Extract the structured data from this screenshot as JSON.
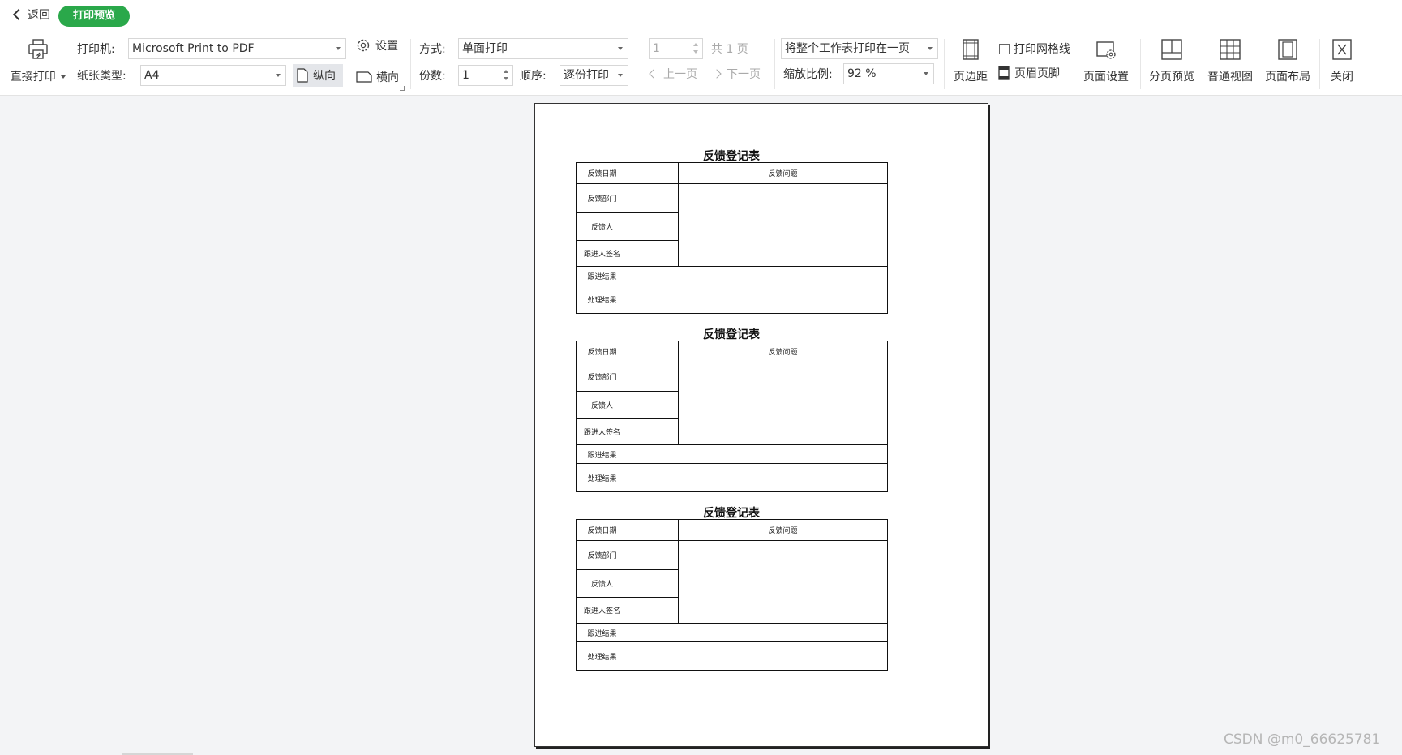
{
  "topbar": {
    "back_label": "返回",
    "mode_label": "打印预览"
  },
  "print": {
    "direct_label": "直接打印",
    "printer_label": "打印机:",
    "printer_value": "Microsoft Print to PDF",
    "settings_label": "设置",
    "paper_label": "纸张类型:",
    "paper_value": "A4",
    "portrait_label": "纵向",
    "landscape_label": "横向",
    "orientation_selected": "portrait"
  },
  "mode": {
    "method_label": "方式:",
    "method_value": "单面打印",
    "copies_label": "份数:",
    "copies_value": "1",
    "order_label": "顺序:",
    "order_value": "逐份打印"
  },
  "pager": {
    "page_value": "1",
    "total_label": "共 1 页",
    "prev_label": "上一页",
    "next_label": "下一页"
  },
  "scale": {
    "fit_value": "将整个工作表打印在一页",
    "zoom_label": "缩放比例:",
    "zoom_value": "92 %"
  },
  "tools": {
    "margins_label": "页边距",
    "gridlines_label": "打印网格线",
    "gridlines_checked": false,
    "header_footer_label": "页眉页脚",
    "page_setup_label": "页面设置",
    "page_break_label": "分页预览",
    "normal_view_label": "普通视图",
    "page_layout_label": "页面布局",
    "close_label": "关闭"
  },
  "form": {
    "title": "反馈登记表",
    "date_label": "反馈日期",
    "issue_label": "反馈问题",
    "dept_label": "反馈部门",
    "person_label": "反馈人",
    "follower_label": "跟进人签名",
    "followup_label": "跟进结果",
    "result_label": "处理结果"
  },
  "watermark": "CSDN @m0_66625781",
  "colors": {
    "accent": "#2aa84a",
    "canvas": "#f3f4f6"
  }
}
